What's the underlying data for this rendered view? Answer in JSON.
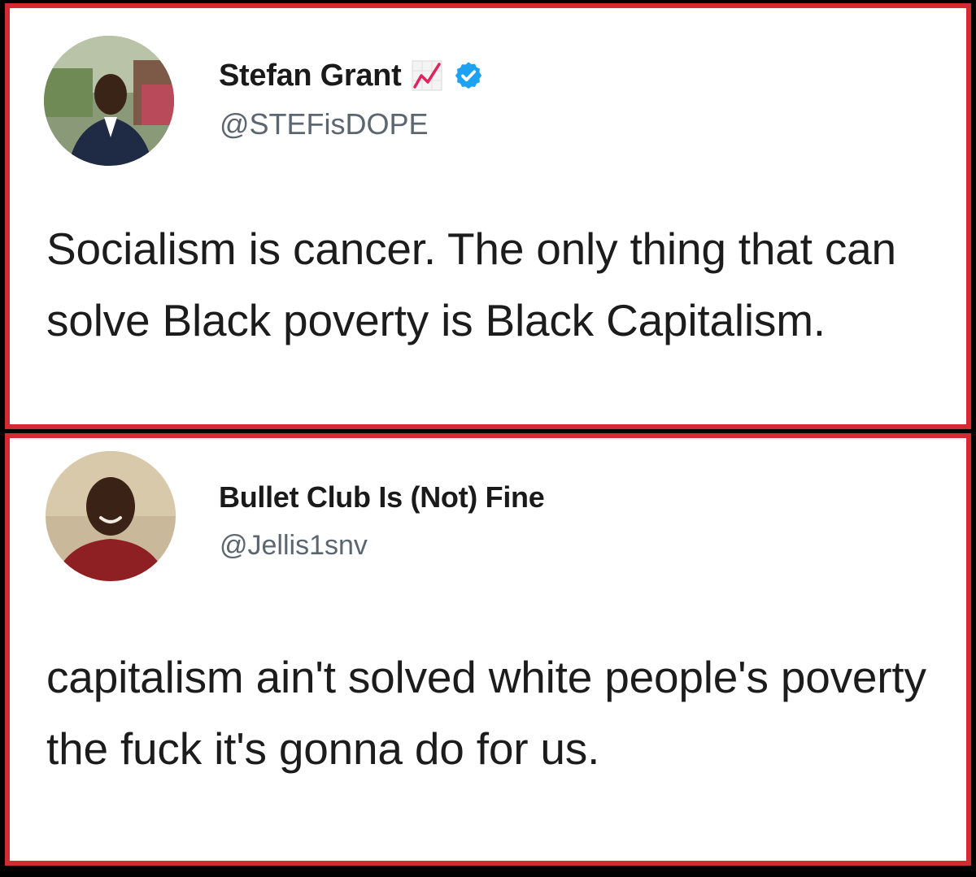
{
  "colors": {
    "frame_border": "#d62a33",
    "background": "#000000",
    "card": "#ffffff",
    "text": "#1c1c1c",
    "handle": "#5b6670",
    "verified": "#1da1f2"
  },
  "tweets": [
    {
      "display_name": "Stefan Grant",
      "handle": "@STEFisDOPE",
      "icons": [
        "chart-increasing-emoji-icon",
        "verified-badge-icon"
      ],
      "text": "Socialism is cancer. The only thing that can solve Black poverty is Black Capitalism."
    },
    {
      "display_name": "Bullet Club Is (Not) Fine",
      "handle": "@Jellis1snv",
      "icons": [],
      "text": "capitalism ain't solved white people's poverty the fuck it's gonna do for us."
    }
  ]
}
